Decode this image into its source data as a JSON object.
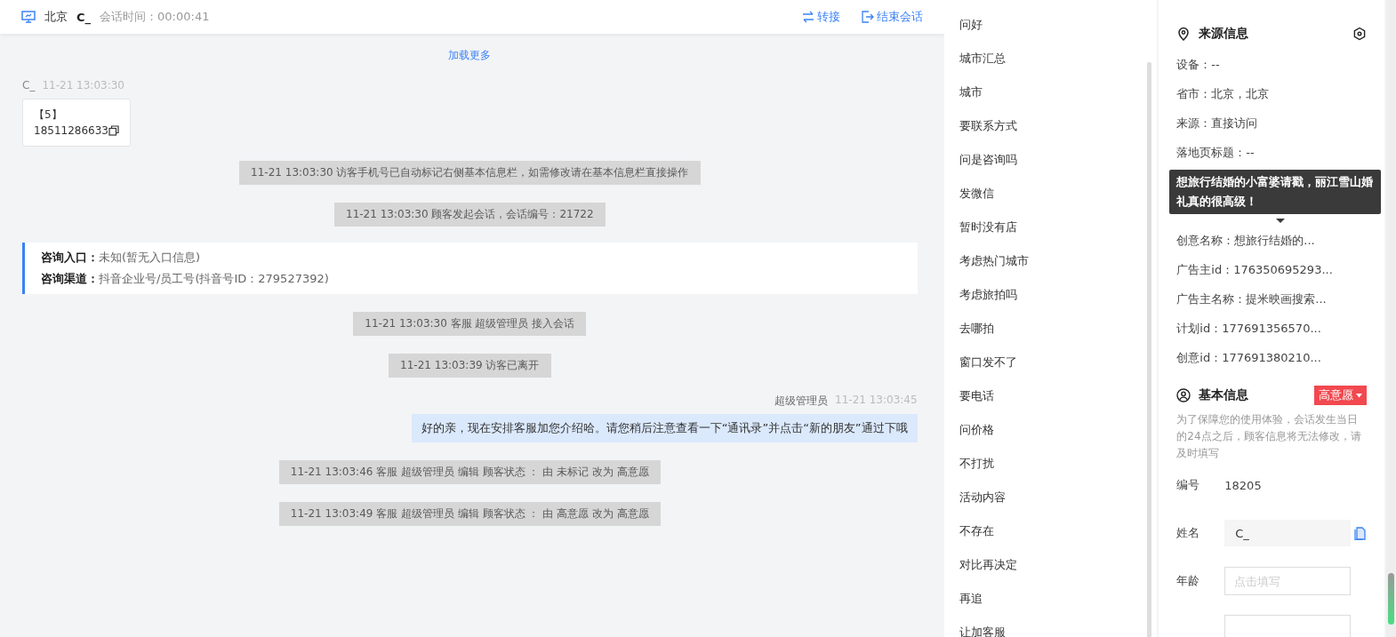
{
  "header": {
    "city": "北京",
    "visitor": "C_",
    "duration_label": "会话时间：",
    "duration": "00:00:41",
    "actions": [
      {
        "kind": "transfer",
        "label": "转接"
      },
      {
        "kind": "end",
        "label": "结束会话"
      }
    ]
  },
  "chat": {
    "load_more": "加载更多",
    "messages": [
      {
        "kind": "visitor",
        "sender": "C_",
        "time": "11-21 13:03:30",
        "lines": [
          "【5】",
          "18511286633"
        ]
      },
      {
        "kind": "system",
        "text": "11-21 13:03:30 访客手机号已自动标记右侧基本信息栏，如需修改请在基本信息栏直接操作"
      },
      {
        "kind": "system",
        "text": "11-21 13:03:30 顾客发起会话，会话编号：21722"
      },
      {
        "kind": "info",
        "fields": [
          {
            "label": "咨询入口：",
            "value": "未知(暂无入口信息)"
          },
          {
            "label": "咨询渠道：",
            "value": "抖音企业号/员工号(抖音号ID：279527392)"
          }
        ]
      },
      {
        "kind": "system",
        "text": "11-21 13:03:30 客服 超级管理员 接入会话"
      },
      {
        "kind": "system",
        "text": "11-21 13:03:39 访客已离开"
      },
      {
        "kind": "agent",
        "sender": "超级管理员",
        "time": "11-21 13:03:45",
        "text": "好的亲，现在安排客服加您介绍哈。请您稍后注意查看一下“通讯录”并点击“新的朋友”通过下哦"
      },
      {
        "kind": "system",
        "text": "11-21 13:03:46 客服 超级管理员 编辑 顾客状态 ： 由 未标记 改为 高意愿"
      },
      {
        "kind": "system",
        "text": "11-21 13:03:49 客服 超级管理员 编辑 顾客状态 ： 由 高意愿 改为 高意愿"
      }
    ]
  },
  "quick_replies": [
    "问好",
    "城市汇总",
    "城市",
    "要联系方式",
    "问是咨询吗",
    "发微信",
    "暂时没有店",
    "考虑热门城市",
    "考虑旅拍吗",
    "去哪拍",
    "窗口发不了",
    "要电话",
    "问价格",
    "不打扰",
    "活动内容",
    "不存在",
    "对比再决定",
    "再追",
    "让加客服"
  ],
  "source_info": {
    "title": "来源信息",
    "rows_before": [
      "设备：--",
      "省市：北京，北京",
      "来源：直接访问",
      "落地页标题：--"
    ],
    "tooltip": "想旅行结婚的小富婆请戳，丽江雪山婚礼真的很高级！",
    "rows_after": [
      "创意名称：想旅行结婚的...",
      "广告主id：176350695293...",
      "广告主名称：提米映画搜索...",
      "计划id：177691356570...",
      "创意id：177691380210..."
    ]
  },
  "basic_info": {
    "title": "基本信息",
    "status": "高意愿",
    "notice": "为了保障您的使用体验，会话发生当日的24点之后，顾客信息将无法修改，请及时填写",
    "fields": [
      {
        "kind": "static",
        "label": "编号",
        "value": "18205"
      },
      {
        "kind": "filled",
        "label": "姓名",
        "value": "C_"
      },
      {
        "kind": "input",
        "label": "年龄",
        "placeholder": "点击填写"
      }
    ]
  }
}
